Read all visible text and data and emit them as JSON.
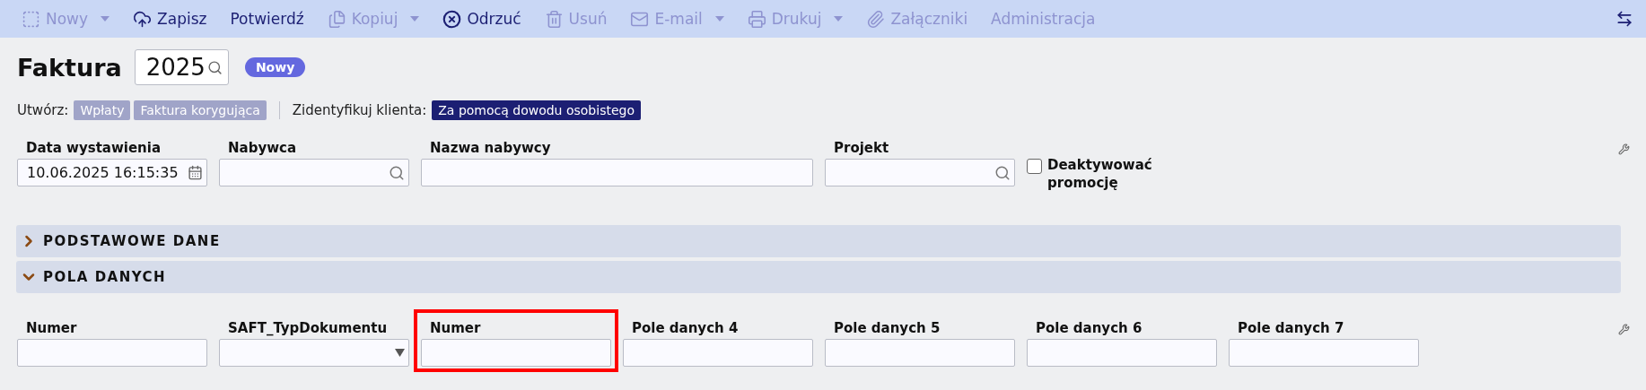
{
  "toolbar": {
    "items": [
      {
        "label": "Nowy",
        "disabled": true,
        "dropdown": true
      },
      {
        "label": "Zapisz",
        "disabled": false,
        "dropdown": false
      },
      {
        "label": "Potwierdź",
        "disabled": false,
        "dropdown": false
      },
      {
        "label": "Kopiuj",
        "disabled": true,
        "dropdown": true
      },
      {
        "label": "Odrzuć",
        "disabled": false,
        "dropdown": false
      },
      {
        "label": "Usuń",
        "disabled": true,
        "dropdown": false
      },
      {
        "label": "E-mail",
        "disabled": true,
        "dropdown": true
      },
      {
        "label": "Drukuj",
        "disabled": true,
        "dropdown": true
      },
      {
        "label": "Załączniki",
        "disabled": true,
        "dropdown": false
      },
      {
        "label": "Administracja",
        "disabled": true,
        "dropdown": false
      }
    ]
  },
  "header": {
    "title": "Faktura",
    "number": "2025",
    "status": "Nowy"
  },
  "actions": {
    "create_label": "Utwórz:",
    "create_buttons": [
      "Wpłaty",
      "Faktura korygująca"
    ],
    "identify_label": "Zidentyfikuj klienta:",
    "identify_button": "Za pomocą dowodu osobistego"
  },
  "fields": [
    {
      "kind": "date",
      "label": "Data wystawienia",
      "value": "10.06.2025 16:15:35"
    },
    {
      "kind": "search",
      "label": "Nabywca"
    },
    {
      "kind": "wide",
      "label": "Nazwa nabywcy"
    },
    {
      "kind": "search",
      "label": "Projekt"
    },
    {
      "kind": "checkbox",
      "label": "Deaktywować promocję",
      "checked": false
    }
  ],
  "sections": [
    {
      "title": "PODSTAWOWE DANE",
      "expanded": false
    },
    {
      "title": "POLA DANYCH",
      "expanded": true
    }
  ],
  "data_fields": [
    {
      "kind": "text",
      "label": "Numer",
      "highlighted": false
    },
    {
      "kind": "select",
      "label": "SAFT_TypDokumentu",
      "highlighted": false
    },
    {
      "kind": "text",
      "label": "Numer",
      "highlighted": true
    },
    {
      "kind": "text",
      "label": "Pole danych 4",
      "highlighted": false
    },
    {
      "kind": "text",
      "label": "Pole danych 5",
      "highlighted": false
    },
    {
      "kind": "text",
      "label": "Pole danych 6",
      "highlighted": false
    },
    {
      "kind": "text",
      "label": "Pole danych 7",
      "highlighted": false
    }
  ]
}
